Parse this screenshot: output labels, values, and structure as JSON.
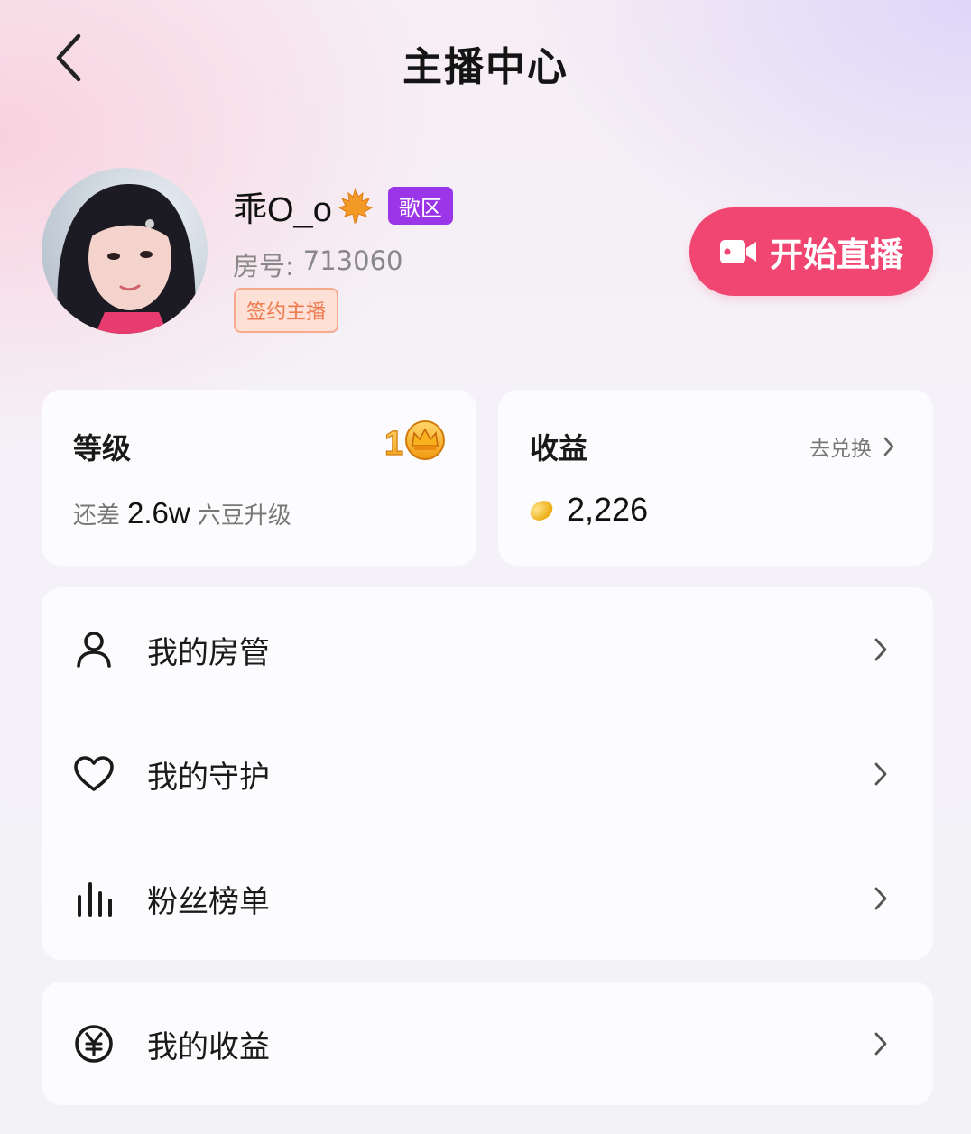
{
  "header": {
    "title": "主播中心",
    "back_icon": "back-arrow-icon"
  },
  "profile": {
    "name": "乖O_o",
    "name_icon": "maple-leaf-icon",
    "zone_badge": "歌区",
    "room_label": "房号:",
    "room_number": "713060",
    "signed_badge": "签约主播",
    "live_button": "开始直播",
    "live_icon": "video-camera-icon"
  },
  "level_card": {
    "title": "等级",
    "level": "1",
    "medal_icon": "crown-icon",
    "prefix": "还差",
    "amount": "2.6w",
    "suffix": "六豆升级"
  },
  "income_card": {
    "title": "收益",
    "link_label": "去兑换",
    "bean_icon": "gold-bean-icon",
    "value": "2,226"
  },
  "menu": [
    {
      "label": "我的房管",
      "icon": "person-icon"
    },
    {
      "label": "我的守护",
      "icon": "heart-icon"
    },
    {
      "label": "粉丝榜单",
      "icon": "bar-chart-icon"
    }
  ],
  "menu2": [
    {
      "label": "我的收益",
      "icon": "yuan-coin-icon"
    }
  ],
  "colors": {
    "accent": "#f24672",
    "zone_badge": "#9b35e8",
    "signed_badge_text": "#f07a4f"
  }
}
